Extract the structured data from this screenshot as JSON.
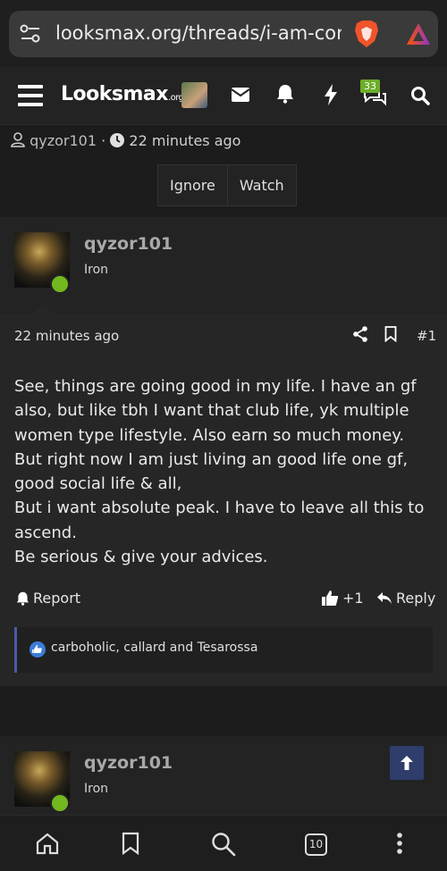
{
  "browser": {
    "url": "looksmax.org/threads/i-am-confus",
    "tab_count": "10"
  },
  "header": {
    "logo_main": "Lo",
    "logo_rest": "ksmax",
    "logo_suffix": ".org",
    "alerts_badge": "33"
  },
  "thread": {
    "author": "qyzor101",
    "time": "22 minutes ago",
    "ignore_label": "Ignore",
    "watch_label": "Watch"
  },
  "post": {
    "username": "qyzor101",
    "rank": "Iron",
    "time": "22 minutes ago",
    "number": "#1",
    "body": [
      "See, things are going good in my life. I have an gf also, but like tbh I want that club life, yk multiple women type lifestyle. Also earn so much money.",
      "But right now I am just living an good life one gf, good social life & all,",
      "But i want absolute peak. I have to leave all this to ascend.",
      "Be serious & give your advices."
    ],
    "report_label": "Report",
    "plus_label": "+1",
    "reply_label": "Reply",
    "reactions": "carboholic, callard and Tesarossa"
  },
  "post2": {
    "username": "qyzor101",
    "rank": "Iron"
  },
  "colors": {
    "online": "#74b81f",
    "badge": "#6cae2a",
    "reaction_border": "#4a5aa8",
    "scrolltop_bg": "#2e3d6a"
  }
}
